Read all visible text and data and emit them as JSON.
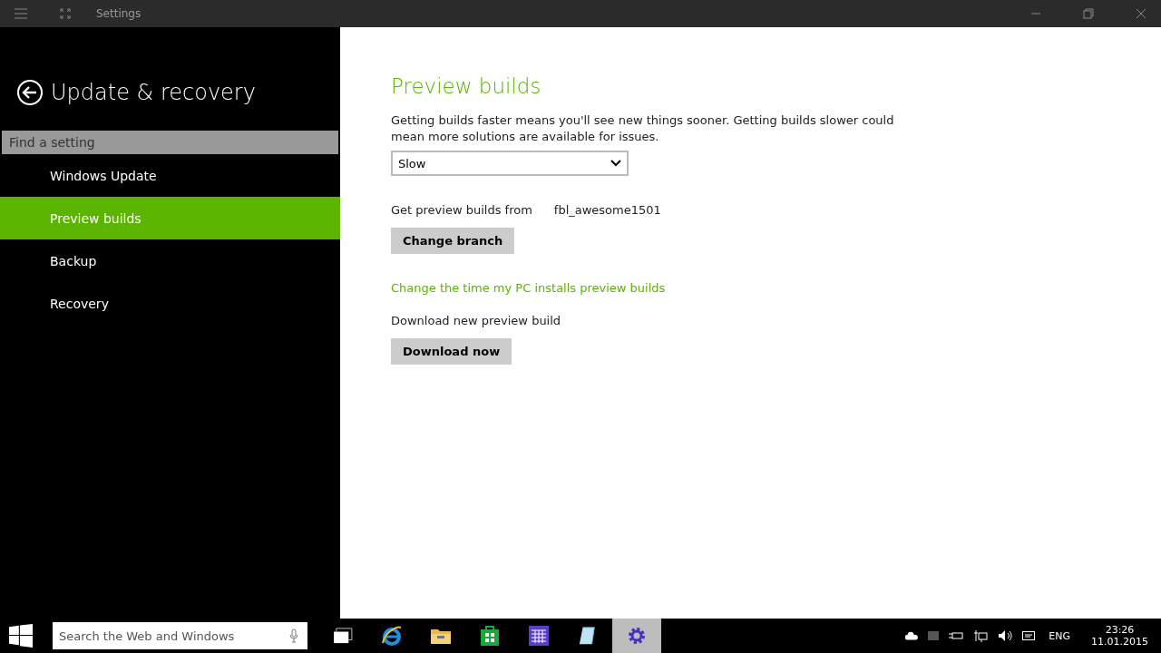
{
  "window": {
    "title": "Settings"
  },
  "sidebar": {
    "title": "Update & recovery",
    "search": {
      "placeholder": "Find a setting"
    },
    "items": [
      {
        "label": "Windows Update",
        "selected": false
      },
      {
        "label": "Preview builds",
        "selected": true
      },
      {
        "label": "Backup",
        "selected": false
      },
      {
        "label": "Recovery",
        "selected": false
      }
    ]
  },
  "content": {
    "heading": "Preview builds",
    "description": "Getting builds faster means you'll see new things sooner. Getting builds slower could mean more solutions are available for issues.",
    "speed_dropdown": {
      "value": "Slow"
    },
    "branch_label": "Get preview builds from",
    "branch_value": "fbl_awesome1501",
    "change_branch_button": "Change branch",
    "schedule_link": "Change the time my PC installs preview builds",
    "download_label": "Download new preview build",
    "download_button": "Download now"
  },
  "taskbar": {
    "search": {
      "placeholder": "Search the Web and Windows"
    },
    "apps": [
      {
        "kind": "taskview",
        "selected": false
      },
      {
        "kind": "browser",
        "selected": false
      },
      {
        "kind": "folder",
        "selected": false
      },
      {
        "kind": "store",
        "selected": false
      },
      {
        "kind": "calendar",
        "selected": false
      },
      {
        "kind": "notepad",
        "selected": false
      },
      {
        "kind": "settings",
        "selected": true
      }
    ],
    "language": "ENG",
    "time": "23:26",
    "date": "11.01.2015"
  }
}
